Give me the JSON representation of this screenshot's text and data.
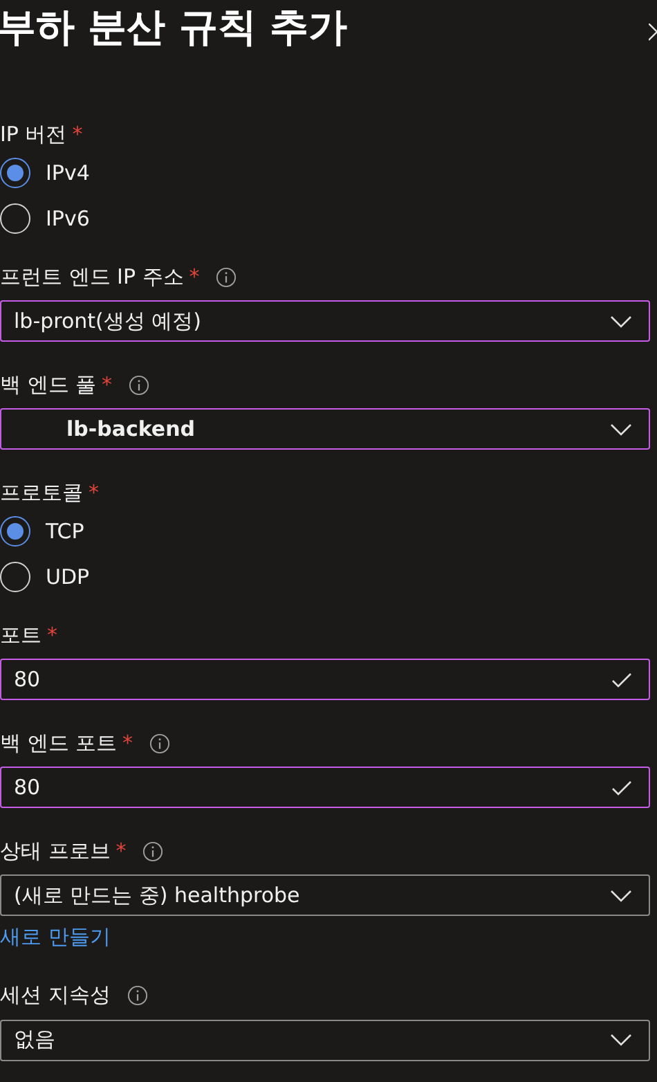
{
  "panel": {
    "title": "부하 분산 규칙 추가"
  },
  "fields": [
    {
      "kind": "radio",
      "label": "IP 버전",
      "required_mark": "*",
      "info": false,
      "options": [
        {
          "label": "IPv4",
          "selected": true
        },
        {
          "label": "IPv6",
          "selected": false
        }
      ]
    },
    {
      "kind": "select",
      "label": "프런트 엔드 IP 주소",
      "required_mark": "*",
      "info": true,
      "value": "lb-pront(생성 예정)",
      "highlighted": true,
      "emphasized": false
    },
    {
      "kind": "select",
      "label": "백 엔드 풀",
      "required_mark": "*",
      "info": true,
      "value": "lb-backend",
      "highlighted": true,
      "emphasized": true
    },
    {
      "kind": "radio",
      "label": "프로토콜",
      "required_mark": "*",
      "info": false,
      "options": [
        {
          "label": "TCP",
          "selected": true
        },
        {
          "label": "UDP",
          "selected": false
        }
      ]
    },
    {
      "kind": "input",
      "label": "포트",
      "required_mark": "*",
      "info": false,
      "value": "80",
      "highlighted": true,
      "valid": true
    },
    {
      "kind": "input",
      "label": "백 엔드 포트",
      "required_mark": "*",
      "info": true,
      "value": "80",
      "highlighted": true,
      "valid": true
    },
    {
      "kind": "select",
      "label": "상태 프로브",
      "required_mark": "*",
      "info": true,
      "value": "(새로 만드는 중) healthprobe",
      "highlighted": false,
      "emphasized": false,
      "link": "새로 만들기"
    },
    {
      "kind": "select",
      "label": "세션 지속성",
      "info": true,
      "value": "없음",
      "highlighted": false,
      "emphasized": false
    }
  ]
}
